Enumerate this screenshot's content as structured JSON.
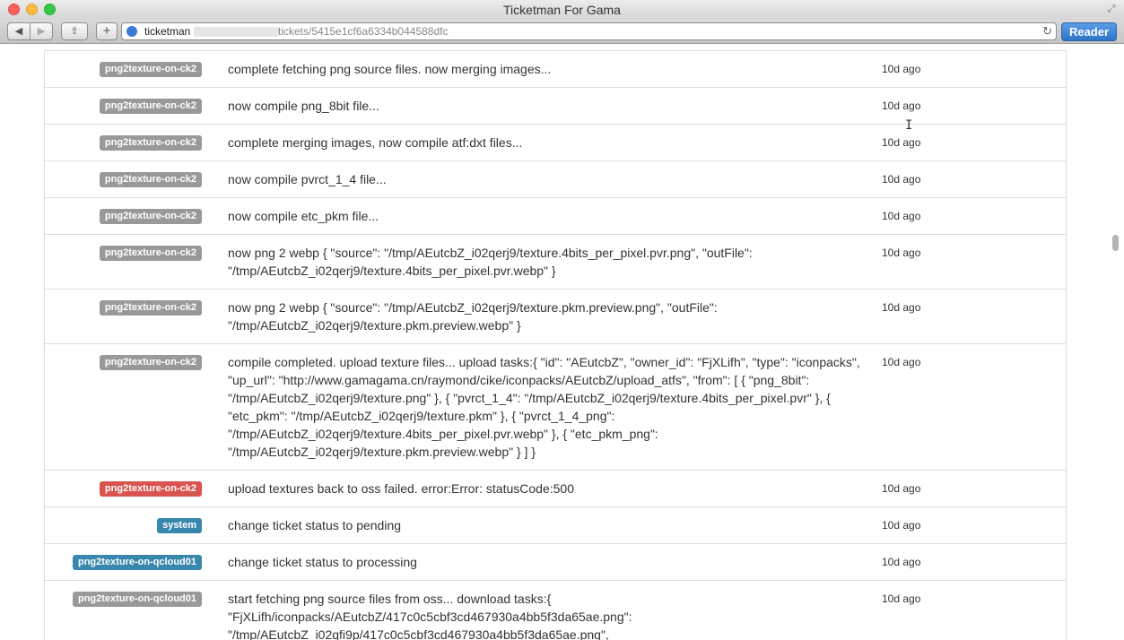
{
  "window": {
    "title": "Ticketman For Gama"
  },
  "toolbar": {
    "back_icon": "◀",
    "forward_icon": "▶",
    "share_icon": "⇪",
    "add_icon": "+",
    "url_host": "ticketman",
    "url_path": "tickets/5415e1cf6a6334b044588dfc",
    "reload_icon": "↻",
    "reader_label": "Reader"
  },
  "colors": {
    "badge_gray": "#999999",
    "badge_red": "#d9534f",
    "badge_blue": "#3a87ad"
  },
  "rows": [
    {
      "tag": "png2texture-on-ck2",
      "tag_color": "gray",
      "message": "complete fetching png source files. now merging images...",
      "time": "10d ago"
    },
    {
      "tag": "png2texture-on-ck2",
      "tag_color": "gray",
      "message": "now compile png_8bit file...",
      "time": "10d ago"
    },
    {
      "tag": "png2texture-on-ck2",
      "tag_color": "gray",
      "message": "complete merging images, now compile atf:dxt files...",
      "time": "10d ago"
    },
    {
      "tag": "png2texture-on-ck2",
      "tag_color": "gray",
      "message": "now compile pvrct_1_4 file...",
      "time": "10d ago"
    },
    {
      "tag": "png2texture-on-ck2",
      "tag_color": "gray",
      "message": "now compile etc_pkm file...",
      "time": "10d ago"
    },
    {
      "tag": "png2texture-on-ck2",
      "tag_color": "gray",
      "message": "now png 2 webp { \"source\": \"/tmp/AEutcbZ_i02qerj9/texture.4bits_per_pixel.pvr.png\", \"outFile\": \"/tmp/AEutcbZ_i02qerj9/texture.4bits_per_pixel.pvr.webp\" }",
      "time": "10d ago"
    },
    {
      "tag": "png2texture-on-ck2",
      "tag_color": "gray",
      "message": "now png 2 webp { \"source\": \"/tmp/AEutcbZ_i02qerj9/texture.pkm.preview.png\", \"outFile\": \"/tmp/AEutcbZ_i02qerj9/texture.pkm.preview.webp\" }",
      "time": "10d ago"
    },
    {
      "tag": "png2texture-on-ck2",
      "tag_color": "gray",
      "message": "compile completed. upload texture files... upload tasks:{ \"id\": \"AEutcbZ\", \"owner_id\": \"FjXLifh\", \"type\": \"iconpacks\", \"up_url\": \"http://www.gamagama.cn/raymond/cike/iconpacks/AEutcbZ/upload_atfs\", \"from\": [ { \"png_8bit\": \"/tmp/AEutcbZ_i02qerj9/texture.png\" }, { \"pvrct_1_4\": \"/tmp/AEutcbZ_i02qerj9/texture.4bits_per_pixel.pvr\" }, { \"etc_pkm\": \"/tmp/AEutcbZ_i02qerj9/texture.pkm\" }, { \"pvrct_1_4_png\": \"/tmp/AEutcbZ_i02qerj9/texture.4bits_per_pixel.pvr.webp\" }, { \"etc_pkm_png\": \"/tmp/AEutcbZ_i02qerj9/texture.pkm.preview.webp\" } ] }",
      "time": "10d ago"
    },
    {
      "tag": "png2texture-on-ck2",
      "tag_color": "red",
      "message": "upload textures back to oss failed. error:Error: statusCode:500",
      "time": "10d ago"
    },
    {
      "tag": "system",
      "tag_color": "blue",
      "message": "change ticket status to pending",
      "time": "10d ago"
    },
    {
      "tag": "png2texture-on-qcloud01",
      "tag_color": "blue",
      "message": "change ticket status to processing",
      "time": "10d ago"
    },
    {
      "tag": "png2texture-on-qcloud01",
      "tag_color": "gray",
      "message": "start fetching png source files from oss... download tasks:{ \"FjXLifh/iconpacks/AEutcbZ/417c0c5cbf3cd467930a4bb5f3da65ae.png\": \"/tmp/AEutcbZ_i02qfi9p/417c0c5cbf3cd467930a4bb5f3da65ae.png\",",
      "time": "10d ago"
    }
  ]
}
